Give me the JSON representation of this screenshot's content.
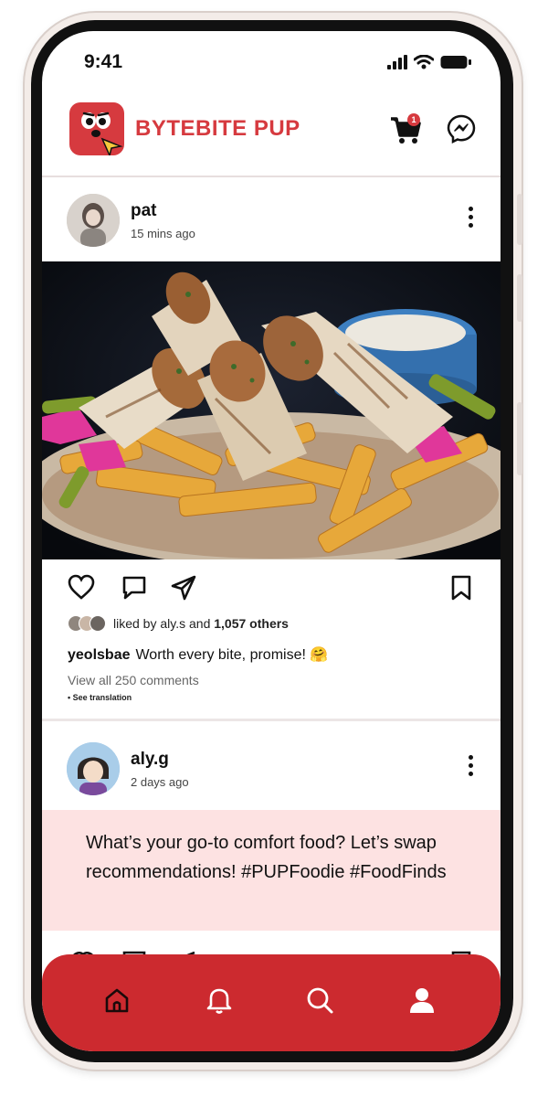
{
  "status_bar": {
    "time": "9:41"
  },
  "app": {
    "brand_name": "BYTEBITE PUP",
    "cart_count": "1",
    "accent_color": "#d63a3f"
  },
  "posts": [
    {
      "username": "pat",
      "time": "15 mins ago",
      "liked_by_user": "aly.s",
      "liked_by_count": "1,057 others",
      "liked_prefix": "liked by",
      "liked_and": "and",
      "caption_user": "yeolsbae",
      "caption_text": "Worth every bite, promise! 🤗",
      "view_comments": "View all 250 comments",
      "see_translation": "• See translation"
    },
    {
      "username": "aly.g",
      "time": "2 days ago",
      "text": "What’s your go-to comfort food? Let’s swap recommendations! #PUPFoodie #FoodFinds"
    }
  ],
  "bottom_nav": [
    "home-icon",
    "bell-icon",
    "search-icon",
    "profile-icon"
  ]
}
